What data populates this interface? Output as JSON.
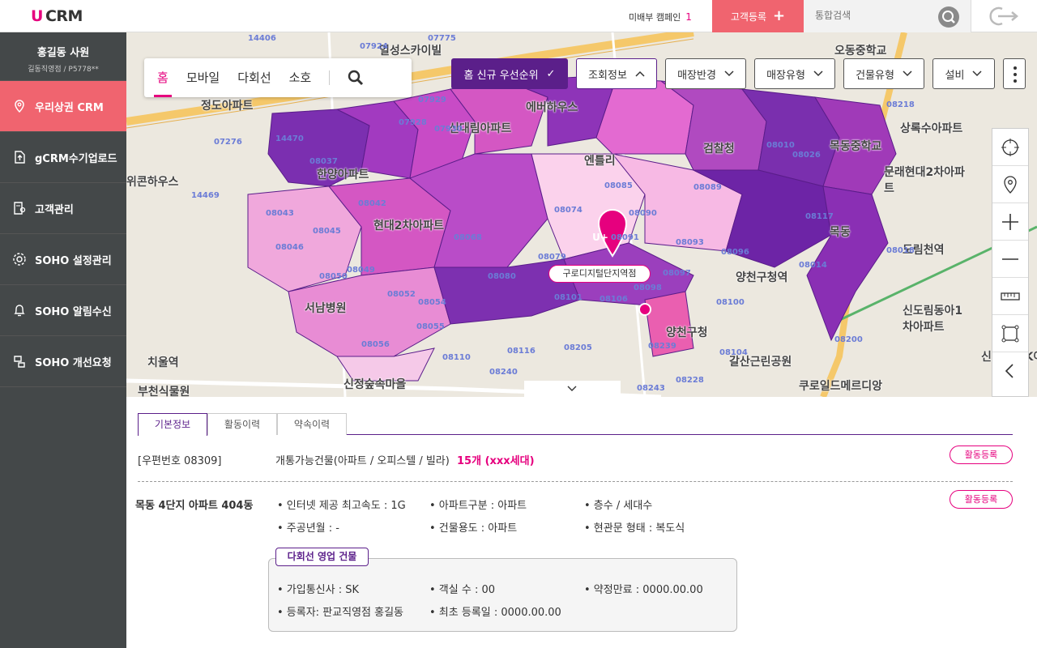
{
  "app": {
    "logo_u": "U",
    "logo_text": "CRM"
  },
  "topbar": {
    "campaign_label": "미배부 캠페인",
    "campaign_count": "1",
    "register_label": "고객등록",
    "search_placeholder": "통합검색"
  },
  "sidebar": {
    "user_name": "홍길동 사원",
    "user_sub": "길동직영점 / P5778**",
    "items": [
      {
        "label": "우리상권 CRM",
        "icon": "location-pin-icon",
        "active": true
      },
      {
        "label": "gCRM수기업로드",
        "icon": "upload-file-icon",
        "active": false
      },
      {
        "label": "고객관리",
        "icon": "customer-doc-icon",
        "active": false
      },
      {
        "label": "SOHO 설정관리",
        "icon": "settings-icon",
        "active": false
      },
      {
        "label": "SOHO 알림수신",
        "icon": "bell-icon",
        "active": false
      },
      {
        "label": "SOHO 개선요청",
        "icon": "request-icon",
        "active": false
      }
    ]
  },
  "map": {
    "tabs": [
      "홈",
      "모바일",
      "다회선",
      "소호"
    ],
    "active_tab": "홈",
    "filters": {
      "priority": "홈 신규 우선순위",
      "lookup": "조회정보",
      "radius": "매장반경",
      "store_type": "매장유형",
      "building_type": "건물유형",
      "equipment": "설비"
    },
    "station_label": "구로디지털단지역점",
    "store_marker": "U+",
    "labels": [
      {
        "text": "정도아파트"
      },
      {
        "text": "일성스카이빌"
      },
      {
        "text": "신대림아파트"
      },
      {
        "text": "에버하우스"
      },
      {
        "text": "엔틀리"
      },
      {
        "text": "한양아파트"
      },
      {
        "text": "현대2차아파트"
      },
      {
        "text": "검찰청"
      },
      {
        "text": "양천구청역"
      },
      {
        "text": "목동중학교"
      },
      {
        "text": "문래현대2차아파트"
      },
      {
        "text": "도림천역"
      },
      {
        "text": "신도림동아1차아파트"
      },
      {
        "text": "서남병원"
      },
      {
        "text": "신정숲속마을"
      },
      {
        "text": "양천구청"
      },
      {
        "text": "갈산근린공원"
      },
      {
        "text": "쿠로일드메르디앙"
      },
      {
        "text": "신도림 SK아파트"
      },
      {
        "text": "치울역"
      },
      {
        "text": "부천식물원"
      },
      {
        "text": "위콘하우스"
      },
      {
        "text": "오동중학교"
      },
      {
        "text": "상록수아파트"
      },
      {
        "text": "목동"
      }
    ],
    "postal_codes": [
      "14406",
      "07775",
      "07924",
      "07929",
      "07928",
      "07930",
      "08037",
      "08042",
      "08043",
      "08045",
      "08046",
      "08049",
      "08050",
      "08052",
      "08054",
      "08055",
      "08056",
      "08068",
      "08074",
      "08079",
      "08080",
      "08085",
      "08089",
      "08090",
      "08091",
      "08093",
      "08096",
      "08097",
      "08098",
      "08101",
      "08106",
      "08100",
      "08104",
      "08110",
      "08116",
      "08117",
      "08014",
      "08018",
      "08200",
      "08205",
      "08239",
      "08240",
      "08243",
      "08228",
      "08218",
      "07276",
      "14469",
      "14470",
      "08026",
      "08010",
      "08011"
    ]
  },
  "panel": {
    "tabs": [
      "기본정보",
      "활동이력",
      "약속이력"
    ],
    "active_tab": "기본정보",
    "postal": "[우편번호 08309]",
    "available_label": "개통가능건물(아파트 / 오피스텔 / 빌라)",
    "available_count": "15개 (xxx세대)",
    "activity_btn": "활동등록",
    "building_name": "목동 4단지 아파트 404동",
    "details": [
      "• 인터넷 제공 최고속도 : 1G",
      "• 아파트구분 : 아파트",
      "• 층수 / 세대수",
      "• 주공년월 : -",
      "• 건물용도 : 아파트",
      "• 현관문 형태 : 복도식"
    ],
    "multiline_tag": "다회선 영업 건물",
    "multiline": [
      "• 가입통신사 : SK",
      "• 객실 수 : 00",
      "• 약정만료 : 0000.00.00",
      "• 등록자: 판교직영점 홍길동",
      "• 최초 등록일 : 0000.00.00"
    ]
  }
}
